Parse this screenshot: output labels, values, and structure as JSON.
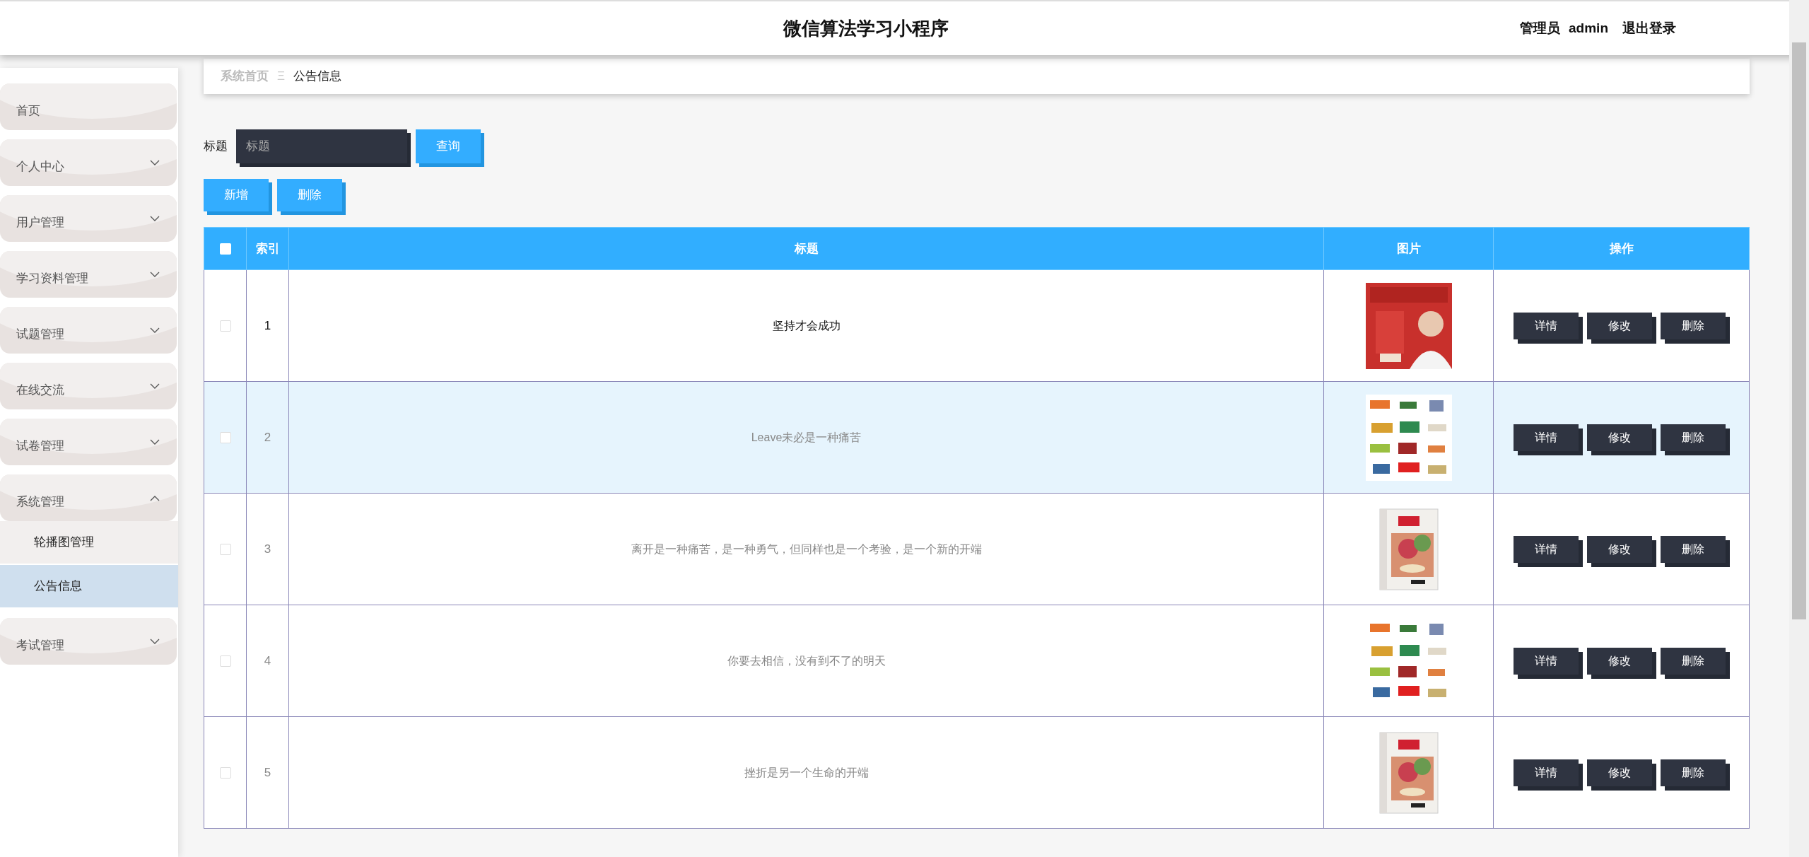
{
  "header": {
    "title": "微信算法学习小程序",
    "user_role": "管理员",
    "user_name": "admin",
    "logout": "退出登录"
  },
  "sidebar": {
    "items": [
      {
        "label": "首页",
        "kind": "link"
      },
      {
        "label": "个人中心",
        "kind": "menu",
        "expanded": false
      },
      {
        "label": "用户管理",
        "kind": "menu",
        "expanded": false
      },
      {
        "label": "学习资料管理",
        "kind": "menu",
        "expanded": false
      },
      {
        "label": "试题管理",
        "kind": "menu",
        "expanded": false
      },
      {
        "label": "在线交流",
        "kind": "menu",
        "expanded": false
      },
      {
        "label": "试卷管理",
        "kind": "menu",
        "expanded": false
      },
      {
        "label": "系统管理",
        "kind": "menu",
        "expanded": true,
        "children": [
          {
            "label": "轮播图管理",
            "selected": false
          },
          {
            "label": "公告信息",
            "selected": true
          }
        ]
      },
      {
        "label": "考试管理",
        "kind": "menu",
        "expanded": false
      }
    ]
  },
  "breadcrumb": {
    "items": [
      "系统首页",
      "公告信息"
    ],
    "separator": "Ξ"
  },
  "search": {
    "label": "标题",
    "placeholder": "标题",
    "button": "查询"
  },
  "toolbar": {
    "buttons": [
      "新增",
      "删除"
    ]
  },
  "table": {
    "columns": [
      "索引",
      "标题",
      "图片",
      "操作"
    ],
    "header_checked": false,
    "rows": [
      {
        "checked": false,
        "highlighted": false,
        "emphasized": true,
        "index": "1",
        "title": "坚持才会成功",
        "actions": [
          "详情",
          "修改",
          "删除"
        ]
      },
      {
        "checked": false,
        "highlighted": true,
        "emphasized": false,
        "index": "2",
        "title": "Leave未必是一种痛苦",
        "actions": [
          "详情",
          "修改",
          "删除"
        ]
      },
      {
        "checked": false,
        "highlighted": false,
        "emphasized": false,
        "index": "3",
        "title": "离开是一种痛苦，是一种勇气，但同样也是一个考验，是一个新的开端",
        "actions": [
          "详情",
          "修改",
          "删除"
        ]
      },
      {
        "checked": false,
        "highlighted": false,
        "emphasized": false,
        "index": "4",
        "title": "你要去相信，没有到不了的明天",
        "actions": [
          "详情",
          "修改",
          "删除"
        ]
      },
      {
        "checked": false,
        "highlighted": false,
        "emphasized": false,
        "index": "5",
        "title": "挫折是另一个生命的开端",
        "actions": [
          "详情",
          "修改",
          "删除"
        ]
      }
    ]
  }
}
